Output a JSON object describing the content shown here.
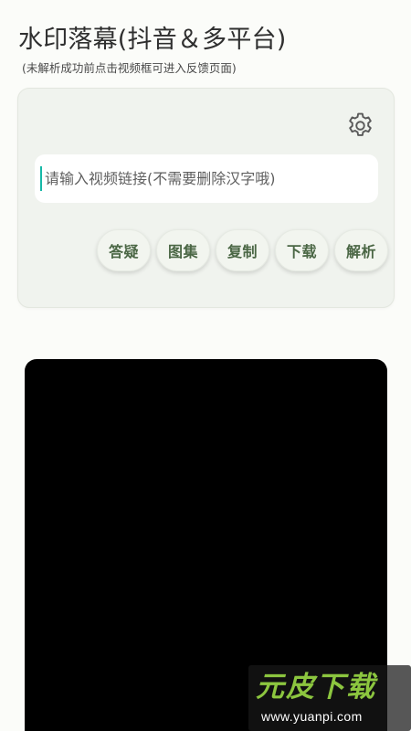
{
  "app": {
    "title": "水印落幕(抖音＆多平台)",
    "subtitle": "(未解析成功前点击视频框可进入反馈页面)"
  },
  "card": {
    "settings_icon": "gear-icon",
    "link_input": {
      "value": "",
      "placeholder": "请输入视频链接(不需要删除汉字哦)"
    },
    "actions": [
      {
        "id": "faq",
        "label": "答疑"
      },
      {
        "id": "gallery",
        "label": "图集"
      },
      {
        "id": "copy",
        "label": "复制"
      },
      {
        "id": "download",
        "label": "下载"
      },
      {
        "id": "parse",
        "label": "解析"
      }
    ]
  },
  "watermark": {
    "logo": "元皮下载",
    "url": "www.yuanpi.com"
  },
  "colors": {
    "background": "#fbfcf9",
    "card": "#f0f3ee",
    "button_text": "#4b6745",
    "cursor": "#16b8a7",
    "video": "#000000",
    "watermark_logo": "#8cc63f"
  }
}
